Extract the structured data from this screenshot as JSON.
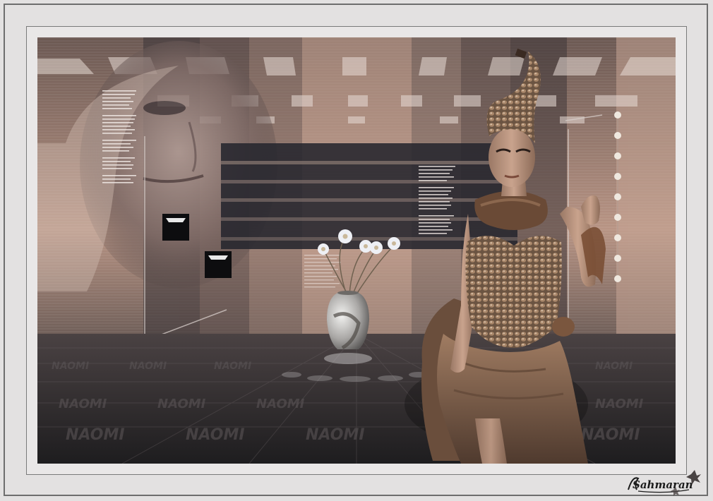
{
  "artwork": {
    "subject": "digital collage",
    "repeated_floor_word": "NAOMI",
    "poem_text_blocks": 3
  },
  "signature": {
    "text": "Sahmaran"
  },
  "colors": {
    "frame_outer": "#e3e1e1",
    "frame_line": "#6e6e6e",
    "tone_dark": "#252324",
    "tone_mid": "#7a6660",
    "tone_light": "#c9a898",
    "dress": "#8b6a52"
  }
}
